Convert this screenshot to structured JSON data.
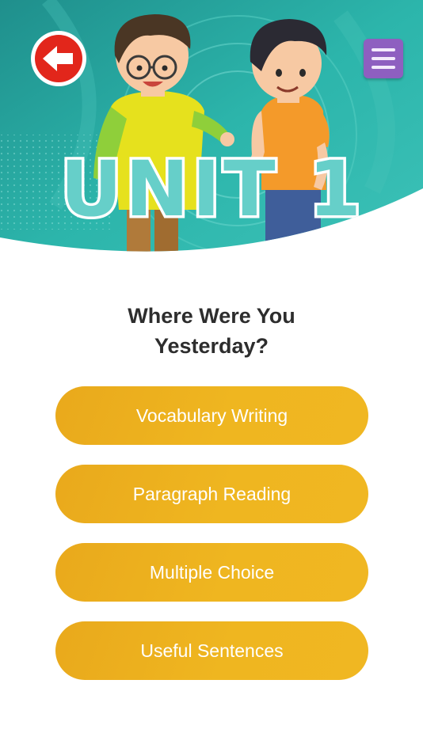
{
  "header": {
    "unit_label": "UNIT 1",
    "back_icon": "arrow-left-icon",
    "menu_icon": "hamburger-menu-icon",
    "colors": {
      "teal": "#29b1a7",
      "unit_letter_fill": "#66cfc9",
      "back_button": "#e2261b",
      "menu_button": "#8e5fc0"
    }
  },
  "lesson": {
    "title_line1": "Where Were You",
    "title_line2": "Yesterday?"
  },
  "menu": {
    "items": [
      {
        "label": "Vocabulary Writing"
      },
      {
        "label": "Paragraph Reading"
      },
      {
        "label": "Multiple Choice"
      },
      {
        "label": "Useful Sentences"
      }
    ],
    "button_color": "#efb420"
  }
}
